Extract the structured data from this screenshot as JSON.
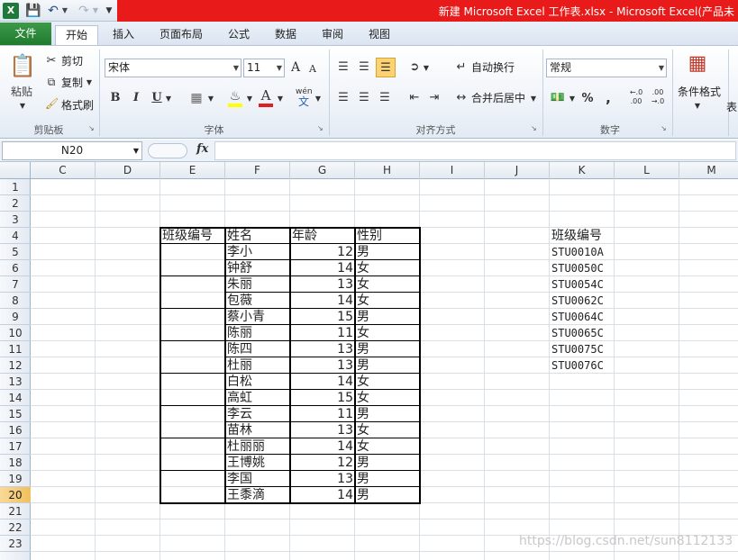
{
  "title_bar": {
    "title": "新建 Microsoft Excel 工作表.xlsx  -  Microsoft Excel(产品未"
  },
  "quick_access": {
    "app_icon": "X",
    "save_icon": "save-icon",
    "undo_icon": "undo-icon",
    "redo_icon": "redo-icon"
  },
  "tabs": [
    {
      "label": "文件"
    },
    {
      "label": "开始"
    },
    {
      "label": "插入"
    },
    {
      "label": "页面布局"
    },
    {
      "label": "公式"
    },
    {
      "label": "数据"
    },
    {
      "label": "审阅"
    },
    {
      "label": "视图"
    }
  ],
  "ribbon": {
    "clipboard": {
      "paste": "粘贴",
      "cut": "剪切",
      "copy": "复制",
      "format_painter": "格式刷",
      "label": "剪贴板"
    },
    "font": {
      "name": "宋体",
      "size": "11",
      "bold": "B",
      "italic": "I",
      "underline": "U",
      "grow": "A",
      "shrink": "A",
      "font_color": "A",
      "wen": "wén",
      "wen_char": "文",
      "label": "字体"
    },
    "alignment": {
      "wrap": "自动换行",
      "merge": "合并后居中",
      "label": "对齐方式"
    },
    "number": {
      "format": "常规",
      "percent": "%",
      "comma": ",",
      "inc_decimal": "←.0 .00",
      "dec_decimal": ".00 →.0",
      "label": "数字"
    },
    "styles": {
      "conditional": "条件格式",
      "table_format": "表"
    }
  },
  "formula_bar": {
    "name_box": "N20",
    "fx": "fx",
    "value": ""
  },
  "columns": [
    "C",
    "D",
    "E",
    "F",
    "G",
    "H",
    "I",
    "J",
    "K",
    "L",
    "M"
  ],
  "rows": [
    "1",
    "2",
    "3",
    "4",
    "5",
    "6",
    "7",
    "8",
    "9",
    "10",
    "11",
    "12",
    "13",
    "14",
    "15",
    "16",
    "17",
    "18",
    "19",
    "20",
    "21",
    "22",
    "23"
  ],
  "selected_row": "20",
  "table": {
    "headers": [
      "班级编号",
      "姓名",
      "年龄",
      "性别"
    ],
    "rows": [
      [
        "",
        "李小",
        "12",
        "男"
      ],
      [
        "",
        "钟舒",
        "14",
        "女"
      ],
      [
        "",
        "朱丽",
        "13",
        "女"
      ],
      [
        "",
        "包薇",
        "14",
        "女"
      ],
      [
        "",
        "蔡小青",
        "15",
        "男"
      ],
      [
        "",
        "陈丽",
        "11",
        "女"
      ],
      [
        "",
        "陈四",
        "13",
        "男"
      ],
      [
        "",
        "杜丽",
        "13",
        "男"
      ],
      [
        "",
        "白松",
        "14",
        "女"
      ],
      [
        "",
        "高虹",
        "15",
        "女"
      ],
      [
        "",
        "李云",
        "11",
        "男"
      ],
      [
        "",
        "苗林",
        "13",
        "女"
      ],
      [
        "",
        "杜丽丽",
        "14",
        "女"
      ],
      [
        "",
        "王博姚",
        "12",
        "男"
      ],
      [
        "",
        "李国",
        "13",
        "男"
      ],
      [
        "",
        "王黍滴",
        "14",
        "男"
      ]
    ]
  },
  "class_list": {
    "header": "班级编号",
    "items": [
      "STU0010A",
      "STU0050C",
      "STU0054C",
      "STU0062C",
      "STU0064C",
      "STU0065C",
      "STU0075C",
      "STU0076C"
    ]
  },
  "watermark": "https://blog.csdn.net/sun8112133"
}
